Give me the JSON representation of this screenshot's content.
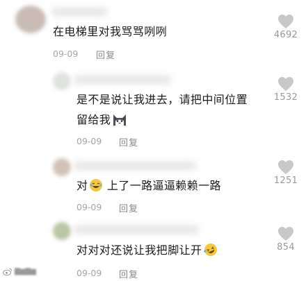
{
  "comments": [
    {
      "text": "在电梯里对我骂骂咧咧",
      "date": "09-09",
      "reply_label": "回复",
      "likes": "4692"
    },
    {
      "text_line1": "是不是说让我进去，请把中间位置",
      "text_line2": "留给我",
      "emoji": "cat-face-icon",
      "date": "09-09",
      "reply_label": "回复",
      "likes": "1532"
    },
    {
      "text_prefix": "对",
      "emoji": "laughing-face-icon",
      "text_suffix": " 上了一路逼逼赖赖一路",
      "date": "09-09",
      "reply_label": "回复",
      "likes": "1251"
    },
    {
      "text": "对对对还说让我把脚让开",
      "emoji": "rolling-laughing-icon",
      "date": "09-09",
      "reply_label": "回复",
      "likes": "854"
    }
  ],
  "colors": {
    "heart": "#c8c8c8",
    "meta": "#a5a5a5"
  }
}
